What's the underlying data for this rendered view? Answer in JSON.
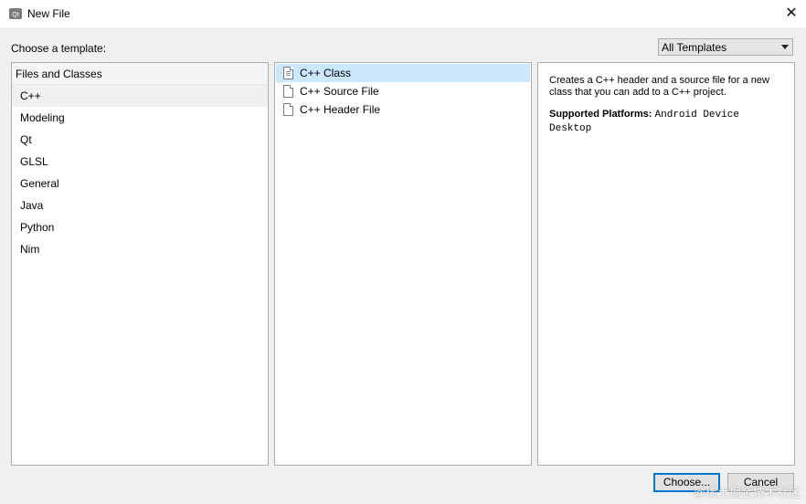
{
  "window": {
    "title": "New File",
    "app_icon": "qt-creator-icon",
    "close_icon": "close-icon"
  },
  "choose_label": "Choose a template:",
  "filter": {
    "selected": "All Templates"
  },
  "categories": {
    "header": "Files and Classes",
    "items": [
      {
        "label": "C++",
        "selected": true
      },
      {
        "label": "Modeling"
      },
      {
        "label": "Qt"
      },
      {
        "label": "GLSL"
      },
      {
        "label": "General"
      },
      {
        "label": "Java"
      },
      {
        "label": "Python"
      },
      {
        "label": "Nim"
      }
    ]
  },
  "templates": [
    {
      "label": "C++ Class",
      "selected": true,
      "icon": "file-icon"
    },
    {
      "label": "C++ Source File",
      "icon": "file-icon"
    },
    {
      "label": "C++ Header File",
      "icon": "file-icon"
    }
  ],
  "details": {
    "description": "Creates a C++ header and a source file for a new class that you can add to a C++ project.",
    "platforms_label": "Supported Platforms:",
    "platforms": [
      "Android Device",
      "Desktop"
    ]
  },
  "buttons": {
    "choose": "Choose...",
    "cancel": "Cancel"
  },
  "watermark": "@稀土掘金技术社区",
  "colors": {
    "selection": "#cce8ff",
    "primary_border": "#0078d7"
  }
}
